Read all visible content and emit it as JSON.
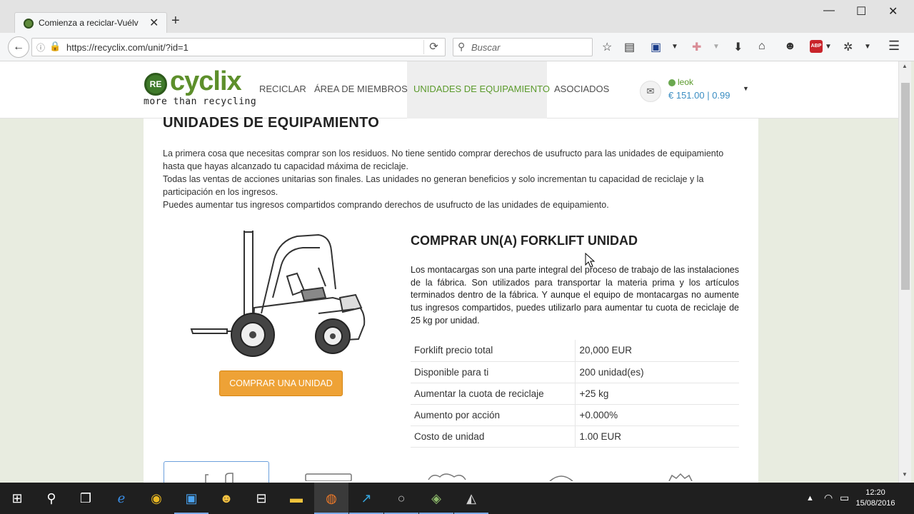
{
  "browser": {
    "tab_title": "Comienza a reciclar-Vuélv",
    "url": "https://recyclix.com/unit/?id=1",
    "search_placeholder": "Buscar"
  },
  "site": {
    "logo_badge": "RE",
    "logo_text": "cyclix",
    "tagline": "more than recycling",
    "nav": [
      "RECICLAR",
      "ÁREA DE MIEMBROS",
      "UNIDADES DE EQUIPAMIENTO",
      "ASOCIADOS"
    ],
    "user_name": "leok",
    "user_balance": "€ 151.00 | 0.99"
  },
  "page": {
    "title": "UNIDADES DE EQUIPAMIENTO",
    "intro": [
      "La primera cosa que necesitas comprar son los residuos. No tiene sentido comprar derechos de usufructo para las unidades de equipamiento hasta que hayas alcanzado tu capacidad máxima de reciclaje.",
      "Todas las ventas de acciones unitarias son finales. Las unidades no generan beneficios y solo incrementan tu capacidad de reciclaje y la participación en los ingresos.",
      "Puedes aumentar tus ingresos compartidos comprando derechos de usufructo de las unidades de equipamiento."
    ],
    "buy_button": "COMPRAR UNA UNIDAD",
    "product_title": "COMPRAR UN(A) FORKLIFT UNIDAD",
    "product_description": "Los montacargas son una parte integral del proceso de trabajo de las instalaciones de la fábrica. Son utilizados para transportar la materia prima y los artículos terminados dentro de la fábrica. Y aunque el equipo de montacargas no aumente tus ingresos compartidos, puedes utilizarlo para aumentar tu cuota de reciclaje de 25 kg por unidad.",
    "specs": [
      {
        "label": "Forklift precio total",
        "value": "20,000 EUR"
      },
      {
        "label": "Disponible para ti",
        "value": "200 unidad(es)"
      },
      {
        "label": "Aumentar la cuota de reciclaje",
        "value": "+25 kg"
      },
      {
        "label": "Aumento por acción",
        "value": "+0.000%"
      },
      {
        "label": "Costo de unidad",
        "value": "1.00 EUR"
      }
    ]
  },
  "taskbar": {
    "time": "12:20",
    "date": "15/08/2016"
  },
  "colors": {
    "brand_green": "#5d8f2b",
    "button_orange": "#eea236",
    "balance_blue": "#3a8dc2"
  }
}
